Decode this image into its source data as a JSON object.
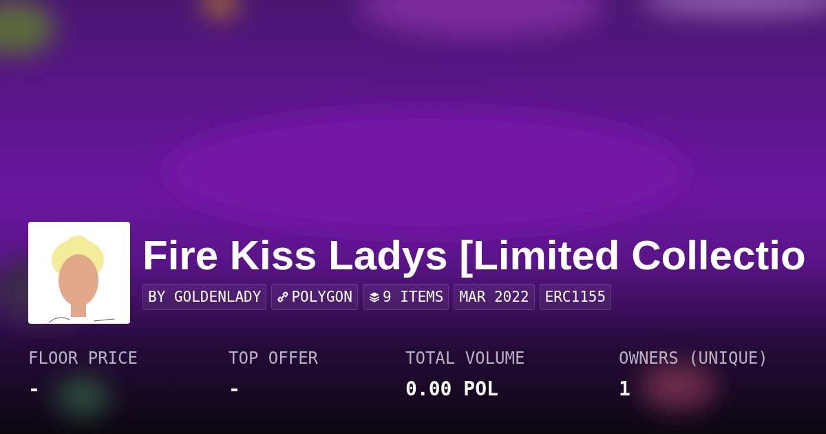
{
  "collection": {
    "title": "Fire Kiss Ladys [Limited Collectio",
    "badges": [
      {
        "kind": "text",
        "label": "BY GOLDENLADY"
      },
      {
        "kind": "chain",
        "label": "POLYGON"
      },
      {
        "kind": "items",
        "label": "9 ITEMS"
      },
      {
        "kind": "text",
        "label": "MAR 2022"
      },
      {
        "kind": "text",
        "label": "ERC1155"
      }
    ]
  },
  "stats": [
    {
      "label": "FLOOR PRICE",
      "value": "-"
    },
    {
      "label": "TOP OFFER",
      "value": "-"
    },
    {
      "label": "TOTAL VOLUME",
      "value": "0.00 POL"
    },
    {
      "label": "OWNERS (UNIQUE)",
      "value": "1"
    }
  ]
}
